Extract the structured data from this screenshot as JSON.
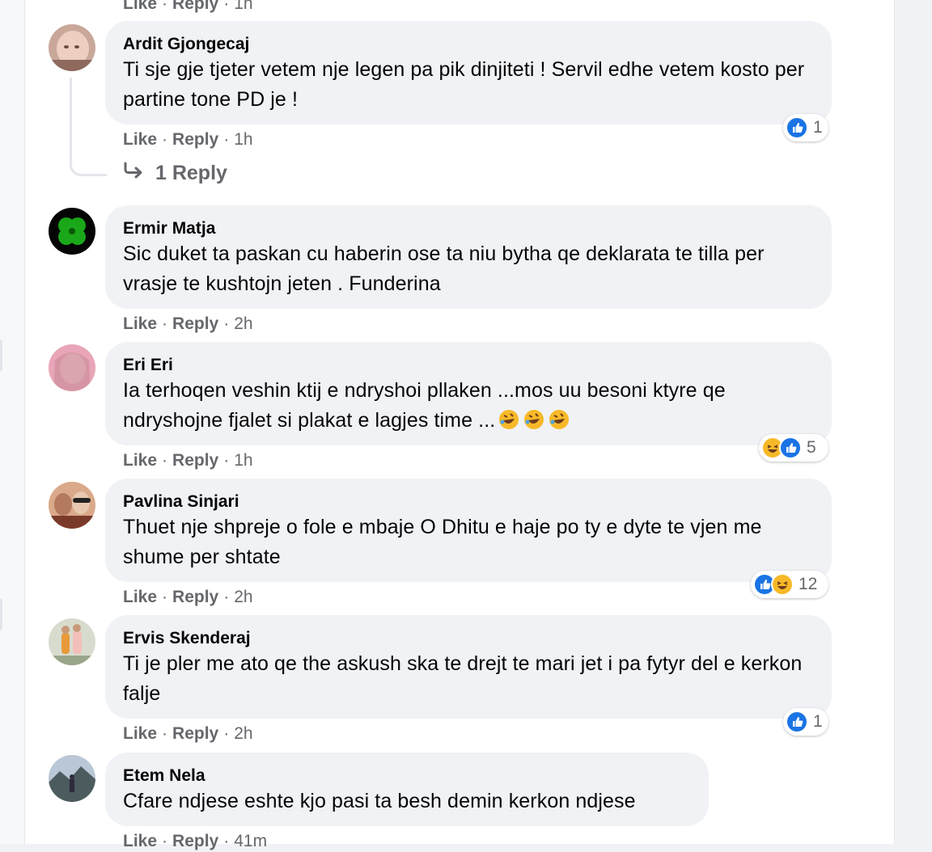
{
  "top_partial_meta": {
    "like": "Like",
    "reply": "Reply",
    "time": "1h"
  },
  "comments": [
    {
      "author": "Ardit Gjongecaj",
      "text": "Ti sje gje tjeter vetem nje legen pa pik dinjiteti ! Servil edhe vetem kosto per partine tone PD je !",
      "like": "Like",
      "reply": "Reply",
      "time": "1h",
      "reactions": {
        "types": [
          "like"
        ],
        "count": "1"
      },
      "replies_label": "1 Reply"
    },
    {
      "author": "Ermir Matja",
      "text": "Sic duket ta paskan cu haberin ose ta niu bytha qe deklarata te tilla per vrasje te kushtojn jeten . Funderina",
      "like": "Like",
      "reply": "Reply",
      "time": "2h"
    },
    {
      "author": "Eri Eri",
      "text": "Ia terhoqen veshin ktij e ndryshoi pllaken ...mos uu besoni ktyre qe ndryshojne fjalet si plakat e lagjes time ...",
      "text_emoji": [
        "rolling-on-floor-laughing-emoji",
        "rolling-on-floor-laughing-emoji",
        "rolling-on-floor-laughing-emoji"
      ],
      "like": "Like",
      "reply": "Reply",
      "time": "1h",
      "reactions": {
        "types": [
          "haha",
          "like"
        ],
        "count": "5"
      }
    },
    {
      "author": "Pavlina Sinjari",
      "text": "Thuet nje shpreje o fole e mbaje O Dhitu e haje po ty e dyte te vjen me shume per shtate",
      "like": "Like",
      "reply": "Reply",
      "time": "2h",
      "reactions": {
        "types": [
          "like",
          "haha"
        ],
        "count": "12"
      }
    },
    {
      "author": "Ervis Skenderaj",
      "text": "Ti je pler me ato qe the askush ska te drejt te mari jet i pa fytyr del e kerkon falje",
      "like": "Like",
      "reply": "Reply",
      "time": "2h",
      "reactions": {
        "types": [
          "like"
        ],
        "count": "1"
      }
    },
    {
      "author": "Etem Nela",
      "text": "Cfare ndjese eshte kjo pasi ta besh demin kerkon ndjese",
      "like": "Like",
      "reply": "Reply",
      "time": "41m"
    }
  ],
  "colors": {
    "bubble": "#f0f2f5",
    "meta": "#65676b",
    "like_blue": "#1b74e4",
    "haha_yellow": "#f7b928"
  }
}
